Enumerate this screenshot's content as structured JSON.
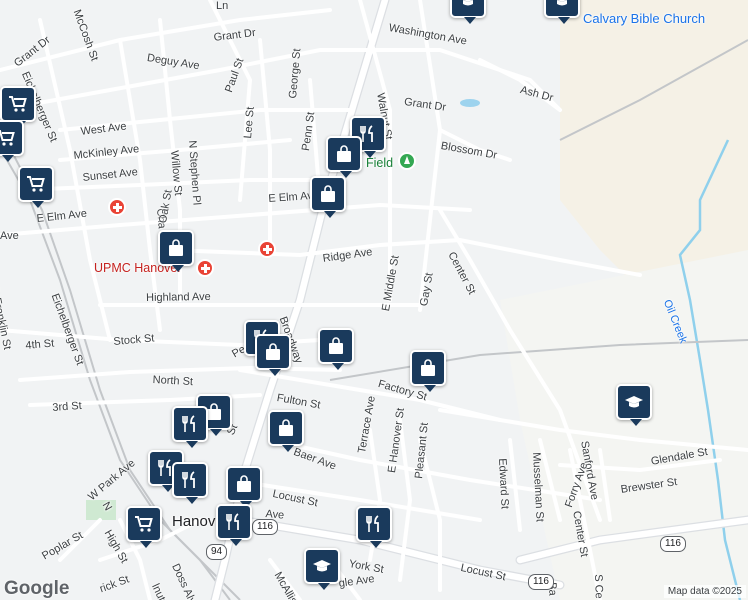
{
  "map": {
    "attribution": "Map data ©2025",
    "logo": "Google",
    "streets": {
      "grant_dr_w": "Grant Dr",
      "grant_dr_nw": "Grant Dr",
      "grant_dr_e": "Grant Dr",
      "mccosh": "McCosh St",
      "deguy": "Deguy Ave",
      "eichelberger_n": "Eichelberger St",
      "eichelberger_s": "Eichelberger St",
      "west_ave": "West Ave",
      "mckinley": "McKinley Ave",
      "sunset": "Sunset Ave",
      "e_elm_w": "E Elm Ave",
      "e_elm_e": "E Elm Av",
      "washington": "Washington Ave",
      "ash": "Ash Dr",
      "blossom": "Blossom Dr",
      "walnut_n": "Walnut St",
      "paul": "Paul St",
      "george": "George St",
      "lee": "Lee St",
      "penn_n": "Penn St",
      "willow": "Willow St",
      "n_stephen": "N Stephen Pl",
      "oak": "Oak St",
      "cha": "Cha",
      "ridge": "Ridge Ave",
      "e_middle": "E Middle St",
      "gay": "Gay St",
      "center_n": "Center St",
      "highland": "Highland Ave",
      "n_franklin": "N Franklin St",
      "fourth": "4th St",
      "stock": "Stock St",
      "penn_s": "Penn",
      "broadway": "Broadway",
      "north_st": "North St",
      "fulton": "Fulton St",
      "third": "3rd St",
      "factory": "Factory St",
      "terrace": "Terrace Ave",
      "e_hanover": "E Hanover St",
      "pleasant": "Pleasant St",
      "edward": "Edward St",
      "musselman": "Musselman St",
      "sanford": "Sanford Ave",
      "glendale": "Glendale St",
      "brewster": "Brewster St",
      "forry": "Forry Ave",
      "center_s": "Center St",
      "s_center_cut": "S Ce",
      "baer": "Baer Ave",
      "locust_w": "Locust St",
      "locust_e": "Locust St",
      "york": "York St",
      "w_park": "W Park Ave",
      "high": "High St",
      "poplar": "Poplar St",
      "n_cut": "N",
      "doss": "Doss Aly",
      "mcallister": "McAllis",
      "rick": "rick St",
      "walnut_s": "lnut St",
      "gle": "gle Ave",
      "avenue_cut": "Ave",
      "ln_cut": "Ln",
      "ba_cut": "Ba",
      "st_cut": "St",
      "ave_cut": "Ave"
    },
    "places": {
      "calvary": "Calvary Bible Church",
      "upmc": "UPMC Hanover",
      "field": "Field",
      "oil_creek": "Oil Creek",
      "hanover": "Hanov"
    },
    "routes": [
      "94",
      "116",
      "116",
      "116"
    ],
    "pins": [
      {
        "kind": "cart",
        "label": "grocery-pin"
      },
      {
        "kind": "cart",
        "label": "grocery-pin"
      },
      {
        "kind": "cart",
        "label": "grocery-pin"
      },
      {
        "kind": "cart",
        "label": "grocery-pin"
      },
      {
        "kind": "food",
        "label": "restaurant-pin"
      },
      {
        "kind": "bag",
        "label": "shopping-pin"
      },
      {
        "kind": "bag",
        "label": "shopping-pin"
      },
      {
        "kind": "bag",
        "label": "shopping-pin"
      },
      {
        "kind": "food",
        "label": "restaurant-pin"
      },
      {
        "kind": "bag",
        "label": "shopping-pin"
      },
      {
        "kind": "bag",
        "label": "shopping-pin"
      },
      {
        "kind": "bag",
        "label": "shopping-pin"
      },
      {
        "kind": "bag",
        "label": "shopping-pin"
      },
      {
        "kind": "food",
        "label": "restaurant-pin"
      },
      {
        "kind": "bag",
        "label": "shopping-pin"
      },
      {
        "kind": "food",
        "label": "restaurant-pin"
      },
      {
        "kind": "food",
        "label": "restaurant-pin"
      },
      {
        "kind": "bag",
        "label": "shopping-pin"
      },
      {
        "kind": "food",
        "label": "restaurant-pin"
      },
      {
        "kind": "food",
        "label": "restaurant-pin"
      },
      {
        "kind": "school",
        "label": "school-pin"
      },
      {
        "kind": "school",
        "label": "school-pin"
      },
      {
        "kind": "school",
        "label": "school-pin"
      },
      {
        "kind": "school",
        "label": "school-pin"
      }
    ],
    "colors": {
      "background": "#f1f3f4",
      "road": "#ffffff",
      "major_road": "#ffffff",
      "casing": "#dadce0",
      "pin": "#1a3a5c",
      "creek": "#7fc8e6",
      "land_tan": "#f3efe3",
      "hospital": "#e94335",
      "park": "#34a853",
      "rail": "#c3c6c9"
    }
  }
}
